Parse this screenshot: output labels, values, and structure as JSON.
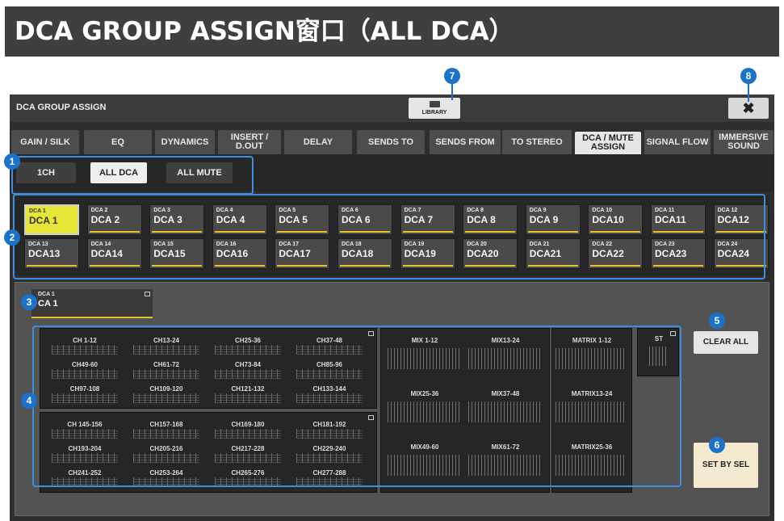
{
  "banner": {
    "title": "DCA GROUP ASSIGN窗口（ALL DCA）"
  },
  "window": {
    "title": "DCA GROUP ASSIGN",
    "library_label": "LIBRARY",
    "close_glyph": "✖"
  },
  "tabs": [
    {
      "label": "GAIN / SILK",
      "active": false
    },
    {
      "label": "EQ",
      "active": false
    },
    {
      "label": "DYNAMICS",
      "active": false
    },
    {
      "label": "INSERT / D.OUT",
      "active": false
    },
    {
      "label": "DELAY",
      "active": false
    },
    {
      "label": "SENDS TO",
      "active": false
    },
    {
      "label": "SENDS FROM",
      "active": false
    },
    {
      "label": "TO STEREO",
      "active": false
    },
    {
      "label": "DCA / MUTE ASSIGN",
      "active": true
    },
    {
      "label": "SIGNAL FLOW",
      "active": false
    },
    {
      "label": "IMMERSIVE SOUND",
      "active": false
    }
  ],
  "modes": [
    {
      "label": "1CH",
      "active": false
    },
    {
      "label": "ALL DCA",
      "active": true
    },
    {
      "label": "ALL MUTE",
      "active": false
    }
  ],
  "dcas": [
    {
      "label": "DCA 1",
      "name": "DCA 1",
      "selected": true
    },
    {
      "label": "DCA 2",
      "name": "DCA 2"
    },
    {
      "label": "DCA 3",
      "name": "DCA 3"
    },
    {
      "label": "DCA 4",
      "name": "DCA 4"
    },
    {
      "label": "DCA 5",
      "name": "DCA 5"
    },
    {
      "label": "DCA 6",
      "name": "DCA 6"
    },
    {
      "label": "DCA 7",
      "name": "DCA 7"
    },
    {
      "label": "DCA 8",
      "name": "DCA 8"
    },
    {
      "label": "DCA 9",
      "name": "DCA 9"
    },
    {
      "label": "DCA 10",
      "name": "DCA10"
    },
    {
      "label": "DCA 11",
      "name": "DCA11"
    },
    {
      "label": "DCA 12",
      "name": "DCA12"
    },
    {
      "label": "DCA 13",
      "name": "DCA13"
    },
    {
      "label": "DCA 14",
      "name": "DCA14"
    },
    {
      "label": "DCA 15",
      "name": "DCA15"
    },
    {
      "label": "DCA 16",
      "name": "DCA16"
    },
    {
      "label": "DCA 17",
      "name": "DCA17"
    },
    {
      "label": "DCA 18",
      "name": "DCA18"
    },
    {
      "label": "DCA 19",
      "name": "DCA19"
    },
    {
      "label": "DCA 20",
      "name": "DCA20"
    },
    {
      "label": "DCA 21",
      "name": "DCA21"
    },
    {
      "label": "DCA 22",
      "name": "DCA22"
    },
    {
      "label": "DCA 23",
      "name": "DCA23"
    },
    {
      "label": "DCA 24",
      "name": "DCA24"
    }
  ],
  "current_dca": {
    "label": "DCA 1",
    "name": "CA 1"
  },
  "channels_a": [
    "CH 1-12",
    "CH13-24",
    "CH25-36",
    "CH37-48",
    "CH49-60",
    "CH61-72",
    "CH73-84",
    "CH85-96",
    "CH97-108",
    "CH109-120",
    "CH121-132",
    "CH133-144"
  ],
  "channels_b": [
    "CH 145-156",
    "CH157-168",
    "CH169-180",
    "CH181-192",
    "CH193-204",
    "CH205-216",
    "CH217-228",
    "CH229-240",
    "CH241-252",
    "CH253-264",
    "CH265-276",
    "CH277-288"
  ],
  "mix_groups": [
    "MIX 1-12",
    "MIX13-24",
    "MIX25-36",
    "MIX37-48",
    "MIX49-60",
    "MIX61-72"
  ],
  "matrix_groups": [
    "MATRIX 1-12",
    "MATRIX13-24",
    "MATRIX25-36"
  ],
  "st_label": "ST",
  "buttons": {
    "clear_all": "CLEAR ALL",
    "set_by_sel": "SET BY SEL"
  },
  "callouts": [
    "1",
    "2",
    "3",
    "4",
    "5",
    "6",
    "7",
    "8"
  ],
  "colors": {
    "accent": "#1a73c9",
    "highlight": "#3d8fdd",
    "selected_dca": "#e6e639",
    "dca_bar": "#e2c12a"
  }
}
